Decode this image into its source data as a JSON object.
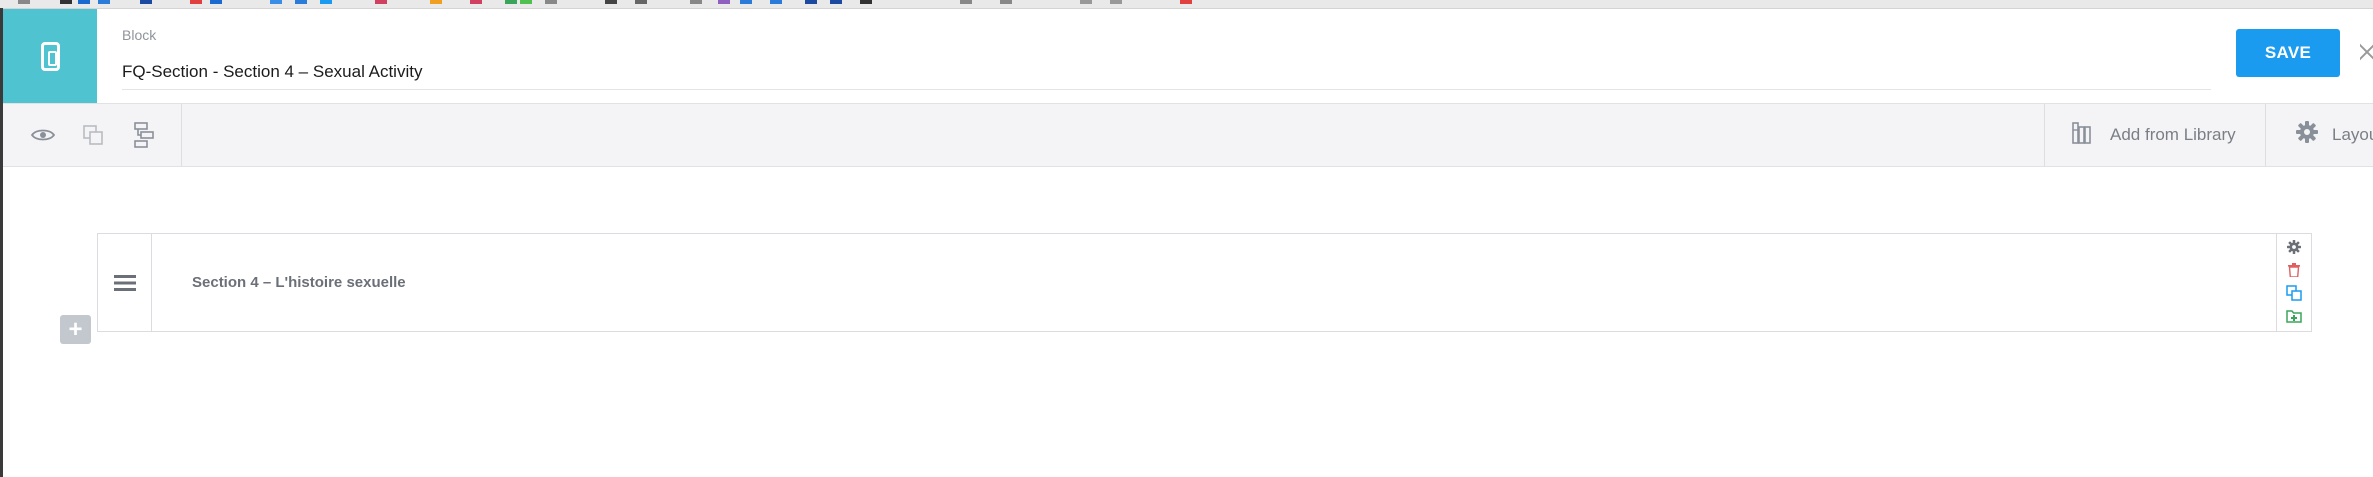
{
  "header": {
    "block_label": "Block",
    "title_value": "FQ-Section - Section 4 – Sexual Activity",
    "save_label": "SAVE",
    "close_icon": "close-icon",
    "logo_icon": "mobile-device-icon"
  },
  "toolbar": {
    "tools": [
      {
        "name": "preview",
        "icon": "eye-icon"
      },
      {
        "name": "duplicate",
        "icon": "copy-icon"
      },
      {
        "name": "structure",
        "icon": "tree-structure-icon"
      }
    ],
    "add_from_library_label": "Add from Library",
    "layout_label": "Layout"
  },
  "canvas": {
    "section": {
      "title": "Section 4 – L'histoire sexuelle",
      "actions": [
        {
          "name": "settings",
          "icon": "gear-icon",
          "color": "#6b7078"
        },
        {
          "name": "delete",
          "icon": "trash-icon",
          "color": "#e06060"
        },
        {
          "name": "clone",
          "icon": "clone-icon",
          "color": "#1a9bf0"
        },
        {
          "name": "save-to-library",
          "icon": "folder-add-icon",
          "color": "#3aa55a"
        }
      ]
    },
    "add_label": "+"
  },
  "colors": {
    "accent": "#4fc3d0",
    "primary_button": "#1a9bf0"
  }
}
